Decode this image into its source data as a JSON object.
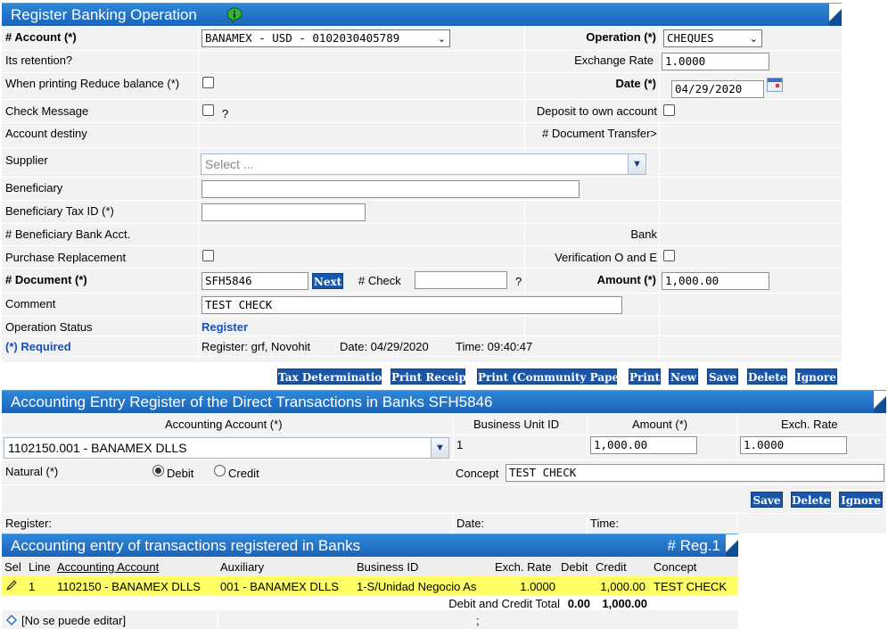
{
  "register": {
    "title": "Register Banking Operation",
    "account_label": "# Account (*)",
    "account_value": "BANAMEX - USD - 0102030405789",
    "operation_label": "Operation (*)",
    "operation_value": "CHEQUES",
    "retention_label": "Its retention?",
    "exchange_rate_label": "Exchange Rate",
    "exchange_rate_value": "1.0000",
    "reduce_balance_label": "When printing Reduce balance (*)",
    "date_label": "Date (*)",
    "date_value": "04/29/2020",
    "check_message_label": "Check Message",
    "check_message_help": "?",
    "deposit_own_label": "Deposit to own account",
    "account_destiny_label": "Account destiny",
    "document_transfer_label": "# Document Transfer>",
    "supplier_label": "Supplier",
    "supplier_placeholder": "Select ...",
    "beneficiary_label": "Beneficiary",
    "beneficiary_value": "",
    "beneficiary_tax_label": "Beneficiary Tax ID (*)",
    "beneficiary_tax_value": "",
    "bank_acct_label": "# Beneficiary Bank Acct.",
    "bank_label": "Bank",
    "purchase_replacement_label": "Purchase Replacement",
    "verification_label": "Verification O and E",
    "document_label": "# Document (*)",
    "document_value": "SFH5846",
    "next_button": "Next",
    "check_label": "# Check",
    "check_value": "",
    "check_help": "?",
    "amount_label": "Amount (*)",
    "amount_value": "1,000.00",
    "comment_label": "Comment",
    "comment_value": "TEST CHECK",
    "status_label": "Operation Status",
    "status_value": "Register",
    "required_label": "(*) Required",
    "register_info": "Register: grf, Novohit",
    "date_info": "Date: 04/29/2020",
    "time_info": "Time: 09:40:47",
    "buttons": [
      "Tax Determination",
      "Print Receipt",
      "Print (Community Paper)",
      "Print",
      "New",
      "Save",
      "Delete",
      "Ignore"
    ]
  },
  "entry": {
    "title": "Accounting Entry Register of the Direct Transactions in Banks SFH5846",
    "col_account": "Accounting Account (*)",
    "col_bu": "Business Unit ID",
    "col_amount": "Amount (*)",
    "col_exch": "Exch. Rate",
    "account_value": "1102150.001 - BANAMEX DLLS",
    "bu_value": "1",
    "amount_value": "1,000.00",
    "exch_value": "1.0000",
    "natural_label": "Natural (*)",
    "debit_label": "Debit",
    "credit_label": "Credit",
    "concept_label": "Concept",
    "concept_value": "TEST CHECK",
    "buttons": [
      "Save",
      "Delete",
      "Ignore"
    ],
    "register_label": "Register:",
    "date_label": "Date:",
    "time_label": "Time:"
  },
  "list": {
    "title": "Accounting entry of transactions registered in Banks",
    "reg_count": "# Reg.1",
    "columns": [
      "Sel",
      "Line",
      "Accounting Account",
      "Auxiliary",
      "Business ID",
      "Exch. Rate",
      "Debit",
      "Credit",
      "Concept"
    ],
    "row": {
      "line": "1",
      "account": "1102150 - BANAMEX DLLS",
      "auxiliary": "001 - BANAMEX DLLS",
      "business": "1-S/Unidad Negocio As",
      "exch": "1.0000",
      "debit": "",
      "credit": "1,000.00",
      "concept": "TEST CHECK"
    },
    "totals_label": "Debit and Credit Total",
    "total_debit": "0.00",
    "total_credit": "1,000.00",
    "footer_note": "[No se puede editar]",
    "footer_sep": ";"
  },
  "colors": {
    "header_blue": "#1a63b8",
    "button_blue": "#1756a8",
    "row_band": "#f2f2f2",
    "selected_row": "#ffff66",
    "status_blue": "#1750b8"
  }
}
